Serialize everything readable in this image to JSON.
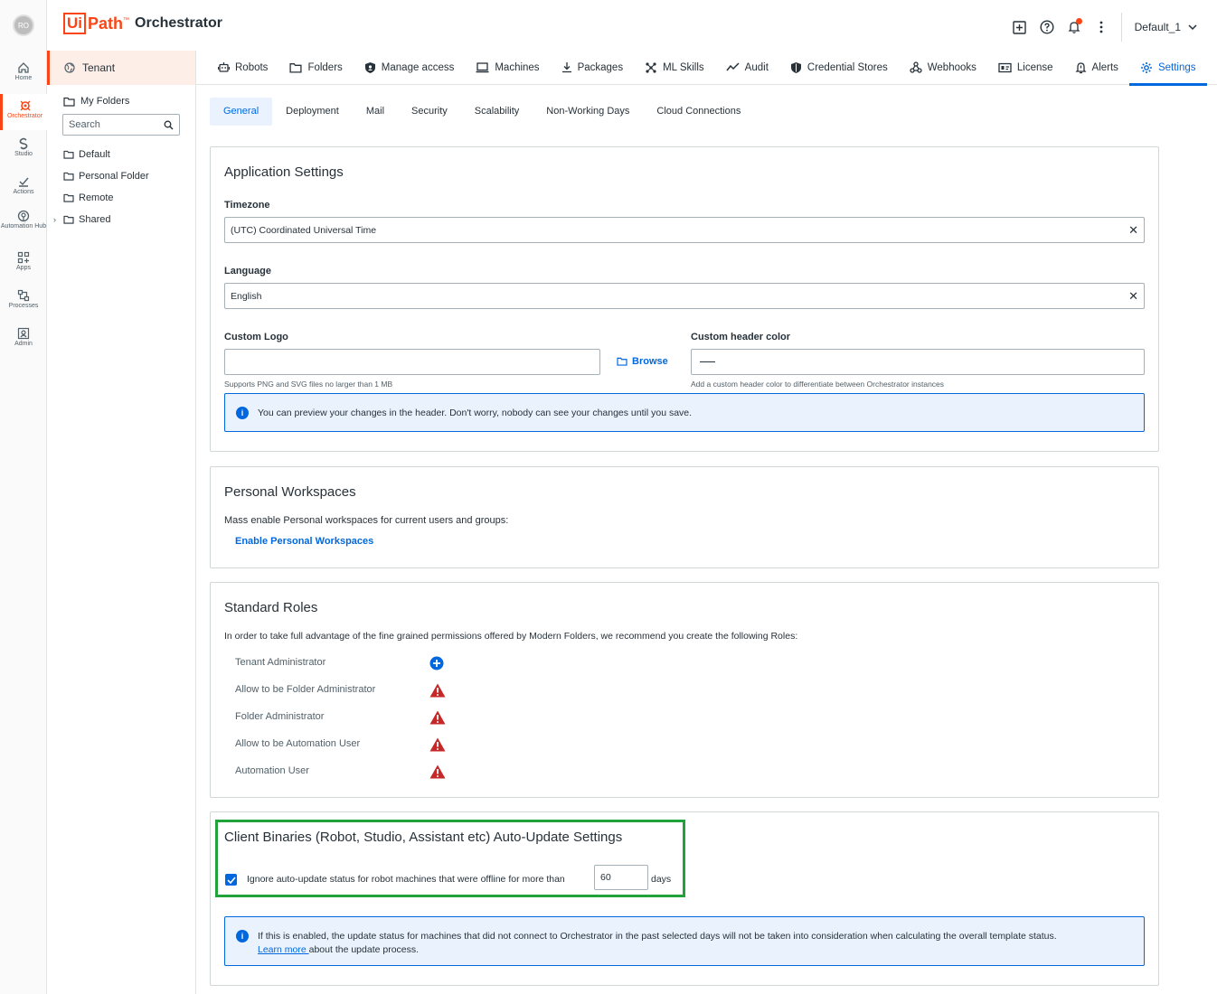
{
  "rail": {
    "avatar": "RO",
    "items": [
      {
        "label": "Home",
        "icon": "home-icon"
      },
      {
        "label": "Orchestrator",
        "icon": "orchestrator-icon"
      },
      {
        "label": "Studio",
        "icon": "studio-icon"
      },
      {
        "label": "Actions",
        "icon": "actions-icon"
      },
      {
        "label": "Automation Hub",
        "icon": "automation-hub-icon"
      },
      {
        "label": "Apps",
        "icon": "apps-icon"
      },
      {
        "label": "Processes",
        "icon": "processes-icon"
      },
      {
        "label": "Admin",
        "icon": "admin-icon"
      }
    ]
  },
  "header": {
    "logo_ui": "Ui",
    "logo_path": "Path",
    "logo_tm": "™",
    "product": "Orchestrator",
    "tenant": "Default_1",
    "brand_color": "#fa4616"
  },
  "sidetree": {
    "tenant_label": "Tenant",
    "my_folders": "My Folders",
    "search_placeholder": "Search",
    "folders": [
      "Default",
      "Personal Folder",
      "Remote",
      "Shared"
    ]
  },
  "nav": {
    "tabs": [
      "Robots",
      "Folders",
      "Manage access",
      "Machines",
      "Packages",
      "ML Skills",
      "Audit",
      "Credential Stores",
      "Webhooks",
      "License",
      "Alerts",
      "Settings"
    ],
    "active": "Settings",
    "accent": "#0067df"
  },
  "subtabs": {
    "items": [
      "General",
      "Deployment",
      "Mail",
      "Security",
      "Scalability",
      "Non-Working Days",
      "Cloud Connections"
    ],
    "active": "General"
  },
  "app_settings": {
    "title": "Application Settings",
    "timezone_label": "Timezone",
    "timezone_value": "(UTC) Coordinated Universal Time",
    "language_label": "Language",
    "language_value": "English",
    "logo_label": "Custom Logo",
    "logo_helper": "Supports PNG and SVG files no larger than 1 MB",
    "browse": "Browse",
    "color_label": "Custom header color",
    "color_helper": "Add a custom header color to differentiate between Orchestrator instances",
    "info": "You can preview your changes in the header. Don't worry, nobody can see your changes until you save."
  },
  "workspaces": {
    "title": "Personal Workspaces",
    "desc": "Mass enable Personal workspaces for current users and groups:",
    "link": "Enable Personal Workspaces"
  },
  "roles": {
    "title": "Standard Roles",
    "desc": "In order to take full advantage of the fine grained permissions offered by Modern Folders, we recommend you create the following Roles:",
    "items": [
      {
        "name": "Tenant Administrator",
        "status": "add"
      },
      {
        "name": "Allow to be Folder Administrator",
        "status": "warning"
      },
      {
        "name": "Folder Administrator",
        "status": "warning"
      },
      {
        "name": "Allow to be Automation User",
        "status": "warning"
      },
      {
        "name": "Automation User",
        "status": "warning"
      }
    ]
  },
  "autoupdate": {
    "title": "Client Binaries (Robot, Studio, Assistant etc) Auto-Update Settings",
    "checkbox_label": "Ignore auto-update status for robot machines that were offline for more than",
    "checked": true,
    "days_value": "60",
    "days_unit": "days",
    "info": "If this is enabled, the update status for machines that did not connect to Orchestrator in the past selected days will not be taken into consideration when calculating the overall template status.",
    "learn_more": "Learn more ",
    "info_tail": "about the update process."
  }
}
